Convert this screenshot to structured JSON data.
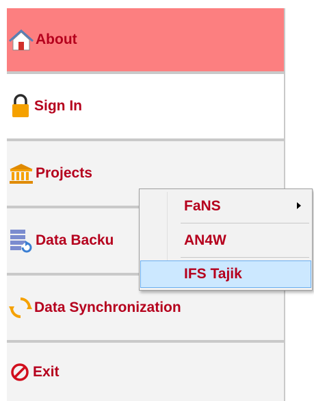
{
  "menu": {
    "items": [
      {
        "label": "About",
        "icon": "home-icon"
      },
      {
        "label": "Sign In",
        "icon": "lock-icon"
      },
      {
        "label": "Projects",
        "icon": "bank-icon"
      },
      {
        "label": "Data Backu",
        "icon": "database-backup-icon"
      },
      {
        "label": "Data Synchronization",
        "icon": "sync-icon"
      },
      {
        "label": "Exit",
        "icon": "exit-icon"
      }
    ],
    "active_index": 0
  },
  "submenu": {
    "items": [
      {
        "label": "FaNS",
        "has_children": true
      },
      {
        "label": "AN4W",
        "has_children": false
      },
      {
        "label": "IFS Tajik",
        "has_children": false,
        "highlighted": true
      }
    ]
  },
  "colors": {
    "active_bg": "#fc7f80",
    "label_text": "#b5001d",
    "hover_bg": "#cce8ff",
    "hover_border": "#6aaef0",
    "icon_orange": "#f5a100",
    "icon_blue": "#3b7fd3"
  }
}
